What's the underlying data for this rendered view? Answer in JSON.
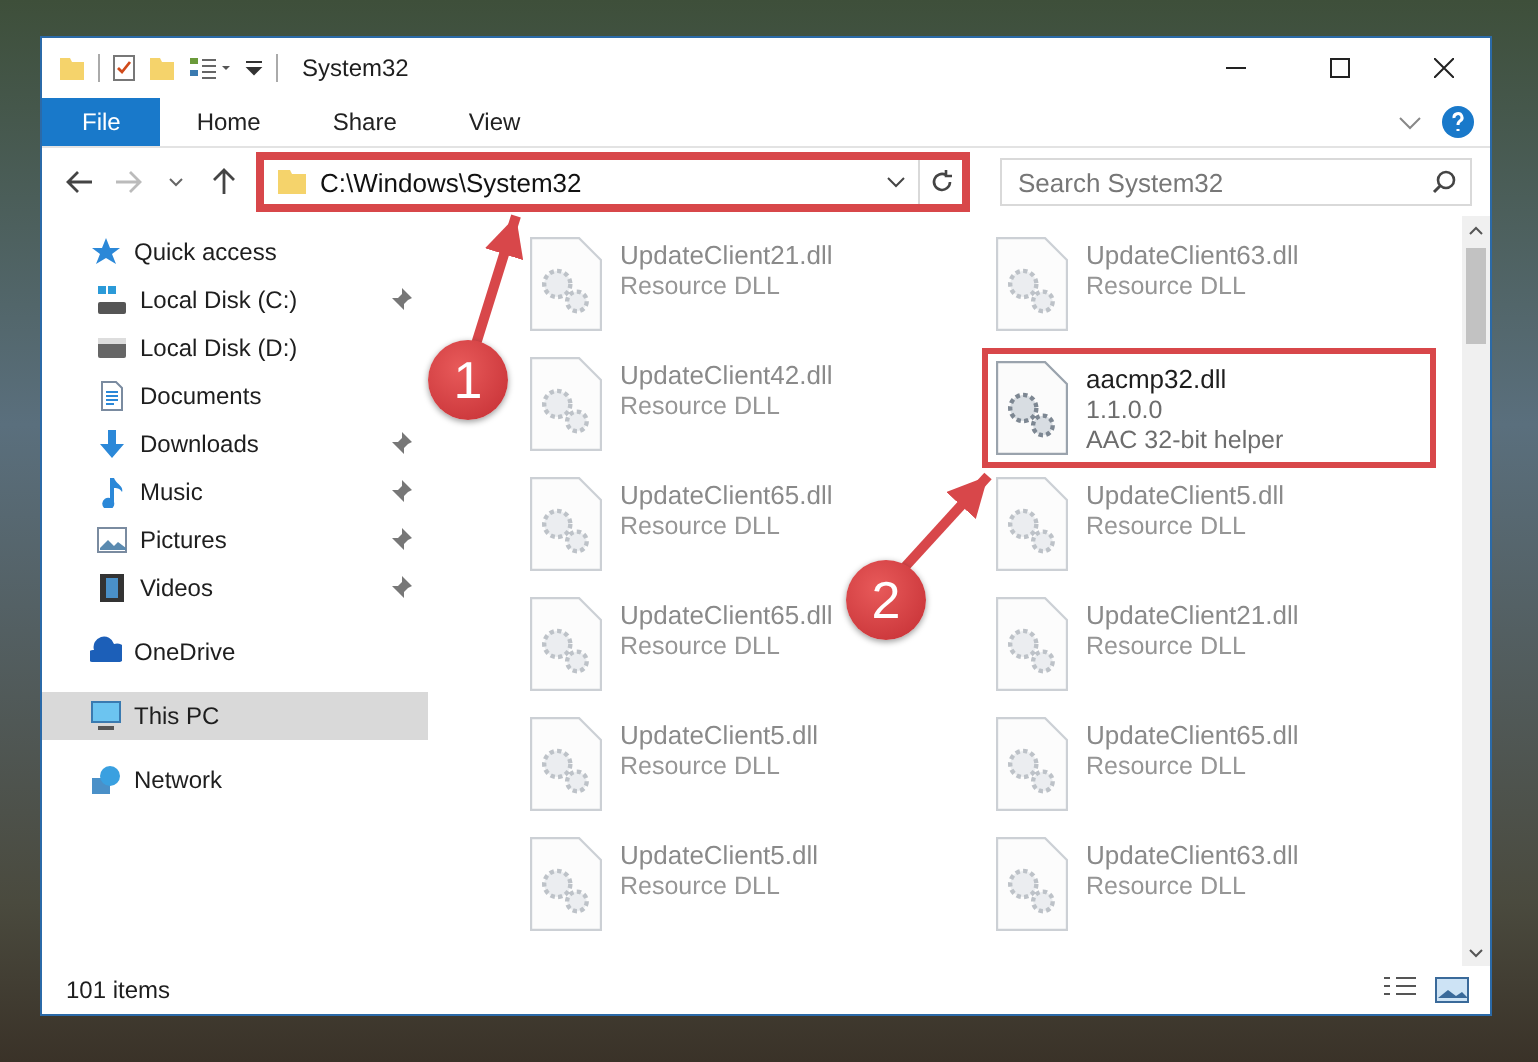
{
  "window": {
    "title": "System32"
  },
  "ribbon_tabs": [
    {
      "label": "File",
      "kind": "file-menu"
    },
    {
      "label": "Home",
      "kind": "tab"
    },
    {
      "label": "Share",
      "kind": "tab"
    },
    {
      "label": "View",
      "kind": "tab"
    }
  ],
  "address_bar": {
    "value": "C:\\Windows\\System32",
    "highlighted": true
  },
  "search": {
    "placeholder": "Search System32"
  },
  "sidebar": {
    "items": [
      {
        "label": "Quick access",
        "kind": "quick-access",
        "selected": false,
        "children": [
          {
            "label": "Local Disk (C:)",
            "kind": "drive-c",
            "pinned": true,
            "selected": false
          },
          {
            "label": "Local Disk (D:)",
            "kind": "drive",
            "pinned": false,
            "selected": false
          },
          {
            "label": "Documents",
            "kind": "documents",
            "pinned": false,
            "selected": false
          },
          {
            "label": "Downloads",
            "kind": "downloads",
            "pinned": true,
            "selected": false
          },
          {
            "label": "Music",
            "kind": "music",
            "pinned": true,
            "selected": false
          },
          {
            "label": "Pictures",
            "kind": "pictures",
            "pinned": true,
            "selected": false
          },
          {
            "label": "Videos",
            "kind": "videos",
            "pinned": true,
            "selected": false
          }
        ]
      },
      {
        "label": "OneDrive",
        "kind": "onedrive",
        "selected": false
      },
      {
        "label": "This PC",
        "kind": "pc",
        "selected": true
      },
      {
        "label": "Network",
        "kind": "network",
        "selected": false
      }
    ]
  },
  "files": [
    {
      "name": "UpdateClient21.dll",
      "details": [
        "Resource DLL"
      ],
      "dimmed": true,
      "highlighted": false
    },
    {
      "name": "UpdateClient63.dll",
      "details": [
        "Resource DLL"
      ],
      "dimmed": true,
      "highlighted": false
    },
    {
      "name": "UpdateClient42.dll",
      "details": [
        "Resource DLL"
      ],
      "dimmed": true,
      "highlighted": false
    },
    {
      "name": "aacmp32.dll",
      "details": [
        "1.1.0.0",
        "AAC 32-bit helper"
      ],
      "dimmed": false,
      "highlighted": true
    },
    {
      "name": "UpdateClient65.dll",
      "details": [
        "Resource DLL"
      ],
      "dimmed": true,
      "highlighted": false
    },
    {
      "name": "UpdateClient5.dll",
      "details": [
        "Resource DLL"
      ],
      "dimmed": true,
      "highlighted": false
    },
    {
      "name": "UpdateClient65.dll",
      "details": [
        "Resource DLL"
      ],
      "dimmed": true,
      "highlighted": false
    },
    {
      "name": "UpdateClient21.dll",
      "details": [
        "Resource DLL"
      ],
      "dimmed": true,
      "highlighted": false
    },
    {
      "name": "UpdateClient5.dll",
      "details": [
        "Resource DLL"
      ],
      "dimmed": true,
      "highlighted": false
    },
    {
      "name": "UpdateClient65.dll",
      "details": [
        "Resource DLL"
      ],
      "dimmed": true,
      "highlighted": false
    },
    {
      "name": "UpdateClient5.dll",
      "details": [
        "Resource DLL"
      ],
      "dimmed": true,
      "highlighted": false
    },
    {
      "name": "UpdateClient63.dll",
      "details": [
        "Resource DLL"
      ],
      "dimmed": true,
      "highlighted": false
    }
  ],
  "status_bar": {
    "text": "101 items"
  },
  "annotations": [
    {
      "label": "1"
    },
    {
      "label": "2"
    }
  ]
}
